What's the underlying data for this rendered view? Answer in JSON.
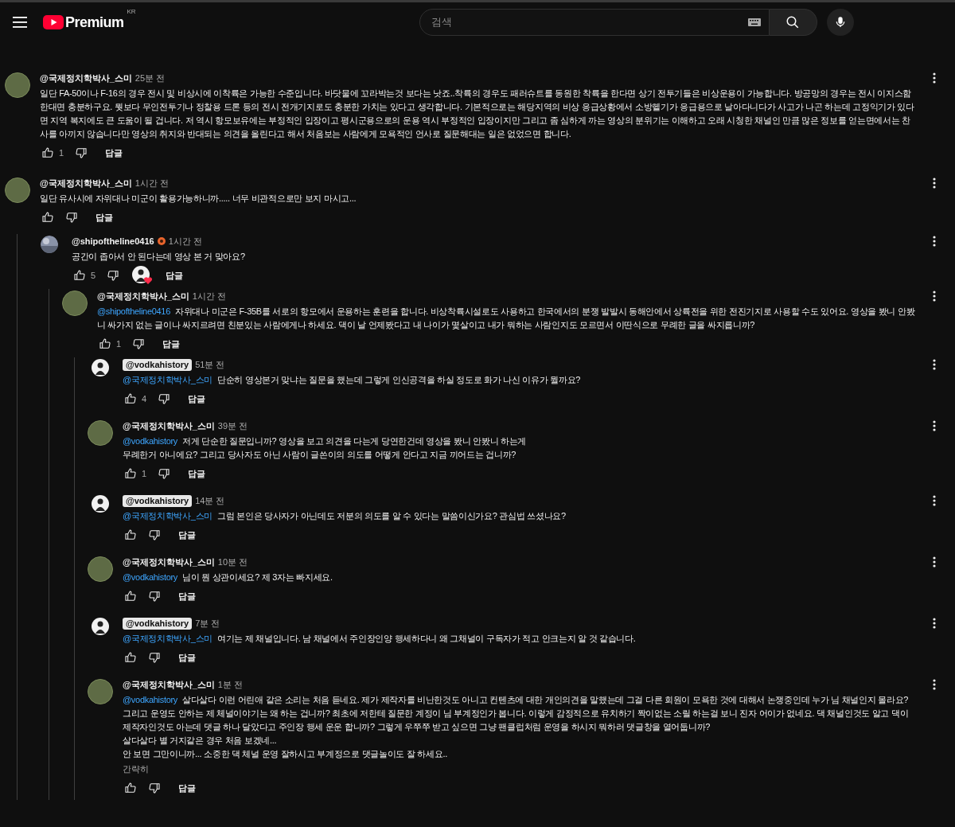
{
  "header": {
    "logo_text": "Premium",
    "region": "KR",
    "search": {
      "placeholder": "검색"
    }
  },
  "comments": [
    {
      "author": "@국제정치학박사_스미",
      "kind": "green",
      "time": "25분 전",
      "owner": false,
      "paragraphs": [
        "일단 FA-50이나 F-16의 경우 전시 및 비상시에 이착륙은 가능한 수준입니다. 바닷물에 꼬라박는것 보다는 낫죠..착륙의 경우도 패러슈트를 동원한 착륙을 한다면 상기 전투기들은 비상운용이 가능합니다. 방공망의 경우는 전시 이지스함 한대면 충분하구요.  뭣보다 무인전투기나 정찰용 드론 등의 전시 전개기지로도 충분한 가치는 있다고 생각합니다. 기본적으로는 해당지역의 비상 응급상황에서 소방헬기가 응급용으로 날아다니다가 사고가 나곤 하는데 고정익기가 있다면 지역 복지에도 큰 도움이 될 겁니다. 저 역시 항모보유에는 부정적인 입장이고 평시군용으로의 운용 역시 부정적인 입장이지만 그리고 좀 심하게 까는 영상의 분위기는 이해하고 오래 시청한 채널인 만큼 많은 정보를 얻는면에서는 찬사를 아끼지 않습니다만 영상의 취지와 반대되는 의견을 올린다고 해서 처음보는 사람에게 모욕적인 언사로 질문해대는 일은 없었으면 합니다."
      ],
      "likes": "1",
      "reply": "답글"
    },
    {
      "author": "@국제정치학박사_스미",
      "kind": "green",
      "time": "1시간 전",
      "owner": false,
      "paragraphs": [
        "일단 유사시에 자위대나 미군이 활용가능하니까..... 너무 비관적으로만 보지 마시고..."
      ],
      "reply": "답글",
      "children": [
        {
          "author": "@shipoftheline0416",
          "badge": true,
          "time": "1시간 전",
          "owner": false,
          "paragraphs": [
            "공간이 좁아서 안 된다는데 영상 본 거 맞아요?"
          ],
          "likes": "5",
          "hearted": true,
          "reply": "답글",
          "children": [
            {
              "author": "@국제정치학박사_스미",
              "kind": "green",
              "time": "1시간 전",
              "owner": false,
              "mention": "@shipoftheline0416",
              "paragraphs": [
                "자위대나 미군은 F-35B를 서로의 항모에서 운용하는 훈련을 합니다. 비상착륙시설로도 사용하고 한국에서의 분쟁 발발시 동해안에서 상륙전을 위한 전진기지로 사용할 수도 있어요. 영상을 봤니 안봤니 싸가지 없는 글이나 싸지르려면 친분있는 사람에게나 하세요. 댁이 날 언제봤다고 내 나이가 몇살이고 내가 뭐하는 사람인지도 모르면서 이딴식으로 무례한 글을 싸지릅니까?"
              ],
              "likes": "1",
              "reply": "답글",
              "children": [
                {
                  "author": "@vodkahistory",
                  "kind": "figure",
                  "time": "51분 전",
                  "owner": true,
                  "mention": "@국제정치학박사_스미",
                  "paragraphs": [
                    "단순히 영상본거 맞냐는 질문을 했는데 그렇게 인신공격을 하실 정도로 화가 나신 이유가 뭘까요?"
                  ],
                  "likes": "4",
                  "reply": "답글"
                },
                {
                  "author": "@국제정치학박사_스미",
                  "kind": "green",
                  "time": "39분 전",
                  "owner": false,
                  "mention": "@vodkahistory",
                  "paragraphs": [
                    "저게 단순한 질문입니까? 영상을 보고 의견을 다는게 당연한건데 영상을 봤니 안봤니 하는게",
                    "무례한거 아니에요? 그리고 당사자도 아닌 사람이 글쓴이의 의도를 어떻게 안다고 지금 끼어드는 겁니까?"
                  ],
                  "likes": "1",
                  "reply": "답글"
                },
                {
                  "author": "@vodkahistory",
                  "kind": "figure",
                  "time": "14분 전",
                  "owner": true,
                  "mention": "@국제정치학박사_스미",
                  "paragraphs": [
                    "그럼 본인은 당사자가 아닌데도 저분의 의도를 알 수 있다는 말씀이신가요? 관심법 쓰셨나요?"
                  ],
                  "reply": "답글"
                },
                {
                  "author": "@국제정치학박사_스미",
                  "kind": "green",
                  "time": "10분 전",
                  "owner": false,
                  "mention": "@vodkahistory",
                  "paragraphs": [
                    "님이 뭔 상관이세요? 제 3자는 빠지세요."
                  ],
                  "reply": "답글"
                },
                {
                  "author": "@vodkahistory",
                  "kind": "figure",
                  "time": "7분 전",
                  "owner": true,
                  "mention": "@국제정치학박사_스미",
                  "paragraphs": [
                    "여기는 제 채널입니다. 남 채널에서 주인장인양 행세하다니 왜 그채널이 구독자가 적고 안크는지 알 것 같습니다."
                  ],
                  "reply": "답글"
                },
                {
                  "author": "@국제정치학박사_스미",
                  "kind": "green",
                  "time": "1분 전",
                  "owner": false,
                  "mention": "@vodkahistory",
                  "paragraphs": [
                    "살다살다 이런 어린애 같은 소리는 처음 듣네요. 제가 제작자를 비난한것도 아니고 컨텐츠에 대한 개인의견을 말했는데 그걸 다른 회원이 모욕한 것에 대해서 논쟁중인데 누가 님 채널인지 몰라요? 그리고 운영도 안하는 제 체널이야기는 왜 하는 겁니까? 최초에 저한테 질문한 계정이 님 부계정인가 봅니다. 이렇게 감정적으로 유치하기 짝이없는 소릴 하는걸 보니 진자 어이가 없네요. 댁 채널인것도 알고 댁이 제작자인것도 아는데 댓글 하나 달았다고 주인장 행세 운운 합니까?  그렇게 우쭈쭈 받고 싶으면 그냥 팬클럽처럼 운영을 하시지 뭐하러 댓글창을 열어둡니까?",
                    "살다살다 별 거지같은 경우 처음 보겠네...",
                    "안 보면 그만이니까... 소중한 댁 체널 운영 잘하시고 부계정으로 댓글놀이도 잘 하세요.."
                  ],
                  "show_less": "간략히",
                  "reply": "답글"
                }
              ]
            }
          ]
        }
      ]
    }
  ]
}
